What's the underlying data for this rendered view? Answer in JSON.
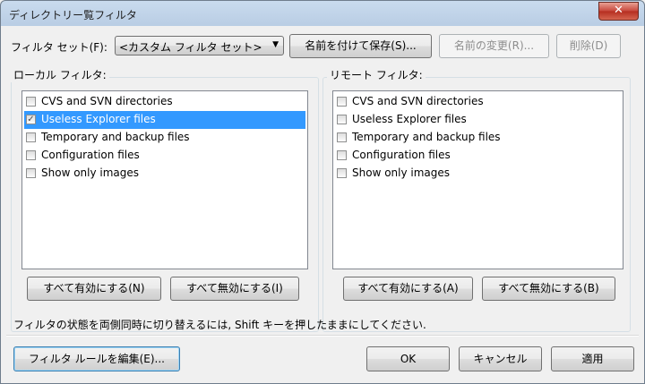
{
  "window": {
    "title": "ディレクトリー覧フィルタ",
    "close_glyph": "✕"
  },
  "filter_set": {
    "label": "フィルタ セット(F):",
    "selected": "<カスタム フィルタ セット>",
    "save_button": "名前を付けて保存(S)...",
    "rename_button": "名前の変更(R)...",
    "delete_button": "削除(D)"
  },
  "local": {
    "label": "ローカル フィルタ:",
    "items": [
      {
        "label": "CVS and SVN directories",
        "checked": false,
        "selected": false
      },
      {
        "label": "Useless Explorer files",
        "checked": true,
        "selected": true
      },
      {
        "label": "Temporary and backup files",
        "checked": false,
        "selected": false
      },
      {
        "label": "Configuration files",
        "checked": false,
        "selected": false
      },
      {
        "label": "Show only images",
        "checked": false,
        "selected": false
      }
    ],
    "enable_all": "すべて有効にする(N)",
    "disable_all": "すべて無効にする(I)"
  },
  "remote": {
    "label": "リモート フィルタ:",
    "items": [
      {
        "label": "CVS and SVN directories",
        "checked": false
      },
      {
        "label": "Useless Explorer files",
        "checked": false
      },
      {
        "label": "Temporary and backup files",
        "checked": false
      },
      {
        "label": "Configuration files",
        "checked": false
      },
      {
        "label": "Show only images",
        "checked": false
      }
    ],
    "enable_all": "すべて有効にする(A)",
    "disable_all": "すべて無効にする(B)"
  },
  "hint": "フィルタの状態を両側同時に切り替えるには, Shift キーを押したままにしてください.",
  "footer": {
    "edit_rules": "フィルタ ルールを編集(E)...",
    "ok": "OK",
    "cancel": "キャンセル",
    "apply": "適用"
  }
}
